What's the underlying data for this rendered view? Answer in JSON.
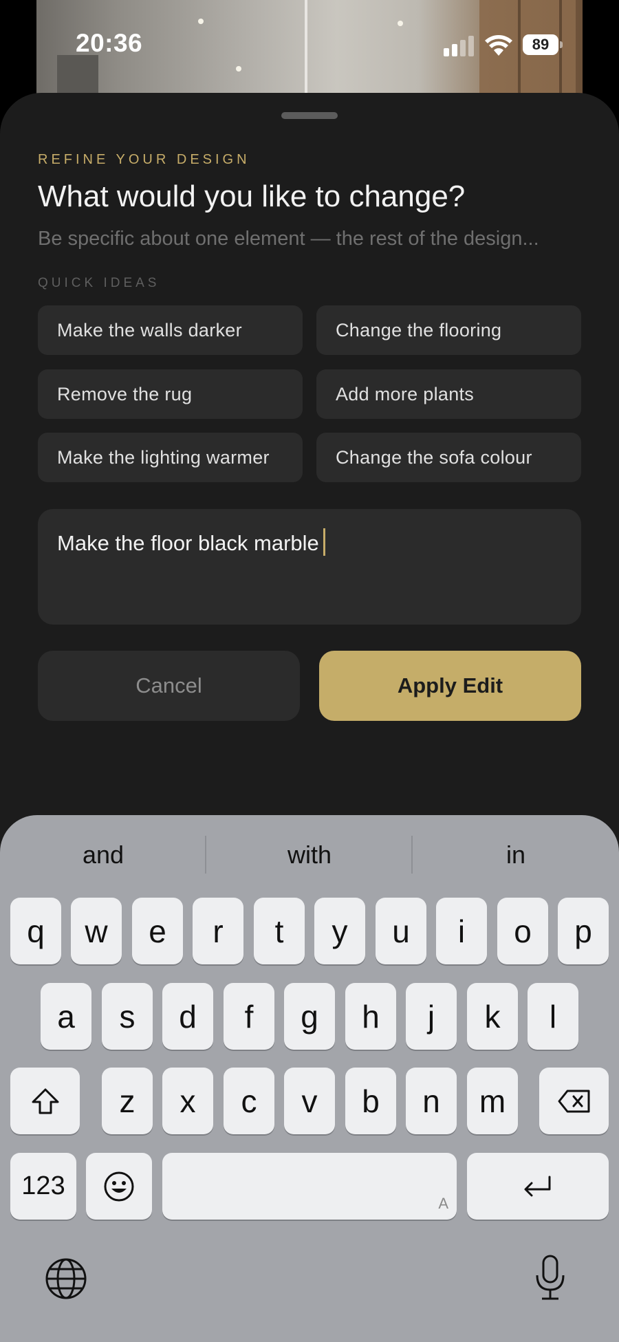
{
  "status_bar": {
    "time": "20:36",
    "battery": "89"
  },
  "sheet": {
    "eyebrow": "REFINE YOUR DESIGN",
    "title": "What would you like to change?",
    "subtitle": "Be specific about one element — the rest of the design...",
    "quick_ideas_label": "QUICK IDEAS",
    "quick_ideas": [
      "Make the walls darker",
      "Change the flooring",
      "Remove the rug",
      "Add more plants",
      "Make the lighting warmer",
      "Change the sofa colour"
    ],
    "input_value": "Make the floor black marble",
    "cancel_label": "Cancel",
    "apply_label": "Apply Edit",
    "accent_color": "#c5ad69"
  },
  "keyboard": {
    "suggestions": [
      "and",
      "with",
      "in"
    ],
    "row1": [
      "q",
      "w",
      "e",
      "r",
      "t",
      "y",
      "u",
      "i",
      "o",
      "p"
    ],
    "row2": [
      "a",
      "s",
      "d",
      "f",
      "g",
      "h",
      "j",
      "k",
      "l"
    ],
    "row3": [
      "z",
      "x",
      "c",
      "v",
      "b",
      "n",
      "m"
    ],
    "numbers_label": "123",
    "space_hint": "A",
    "icons": [
      "shift-icon",
      "backspace-icon",
      "emoji-icon",
      "return-icon",
      "globe-icon",
      "microphone-icon"
    ]
  }
}
